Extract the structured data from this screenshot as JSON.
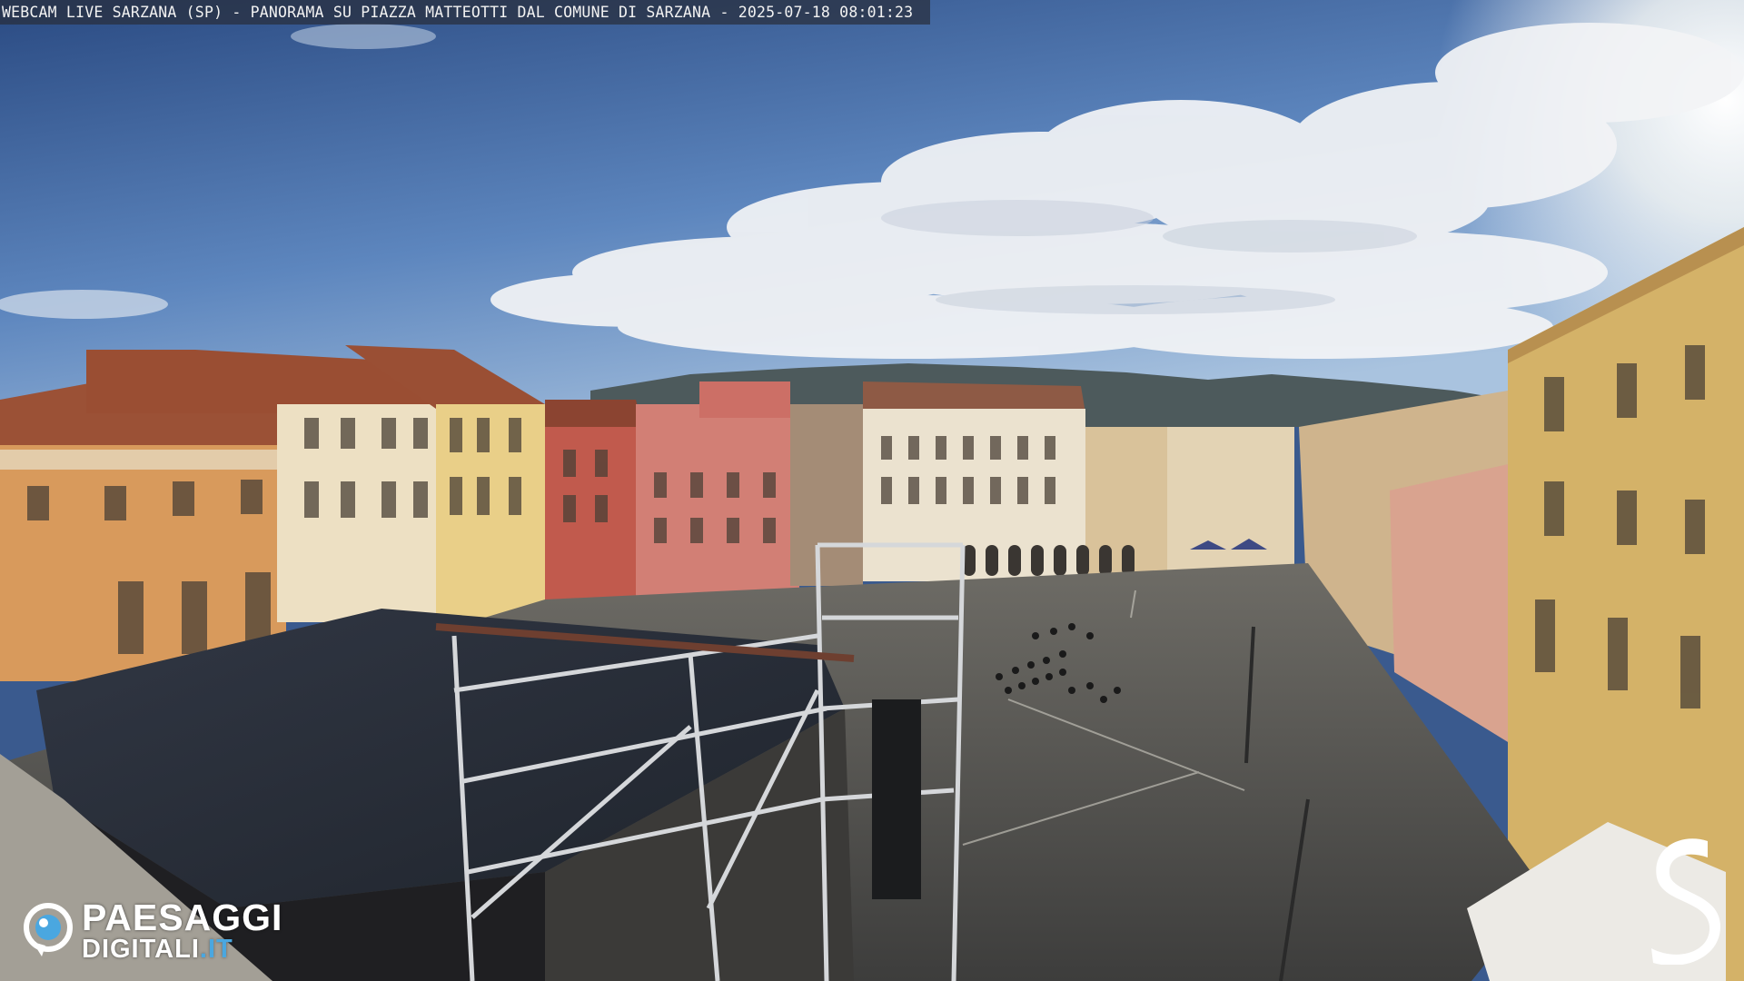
{
  "overlay": {
    "caption": "WEBCAM LIVE SARZANA (SP) - PANORAMA SU PIAZZA MATTEOTTI DAL COMUNE DI SARZANA - 2025-07-18  08:01:23"
  },
  "logos": {
    "provider_line1": "PAESAGGI",
    "provider_line2a": "DIGITALI",
    "provider_line2b": ".IT",
    "accent_color": "#4aa7e0",
    "corner_logo_icon": "letter-s-logo-icon"
  },
  "colors": {
    "sky_top": "#2e4f86",
    "sky_bottom": "#8fb1d6",
    "ochre": "#d89a5c",
    "red_facade": "#c15a4d",
    "pavement": "#4c4c4a",
    "stage_roof": "#2a2f38"
  }
}
